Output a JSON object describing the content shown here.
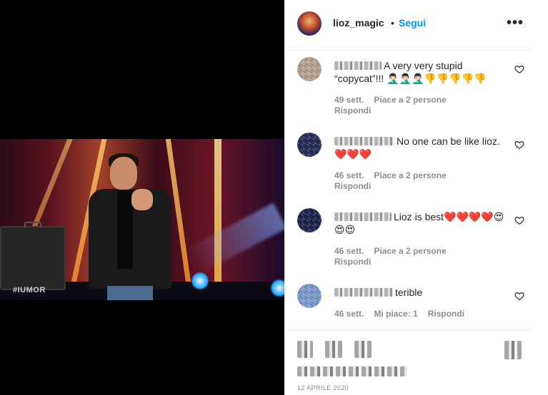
{
  "video": {
    "watermark": "#IUMOR"
  },
  "header": {
    "username": "lioz_magic",
    "separator": "•",
    "follow_label": "Segui",
    "more_label": "•••"
  },
  "comments": [
    {
      "text": "A very very stupid “copycat”!!! 🤦🏻‍♂️🤦🏻‍♂️🤦🏻‍♂️👎👎👎👎👎",
      "time": "49 sett.",
      "likes": "Piace a 2 persone",
      "reply": "Rispondi"
    },
    {
      "text": "No one can be like lioz.❤️❤️❤️",
      "time": "46 sett.",
      "likes": "Piace a 2 persone",
      "reply": "Rispondi"
    },
    {
      "text": "Lioz is best❤️❤️❤️❤️😍😍😍",
      "time": "46 sett.",
      "likes": "Piace a 2 persone",
      "reply": "Rispondi"
    },
    {
      "text": "terible",
      "time": "46 sett.",
      "likes": "Mi piace: 1",
      "reply": "Rispondi"
    }
  ],
  "footer": {
    "date": "12 APRILE 2020"
  },
  "colors": {
    "follow": "#0095f6",
    "meta": "#8e8e8e",
    "text": "#262626"
  }
}
